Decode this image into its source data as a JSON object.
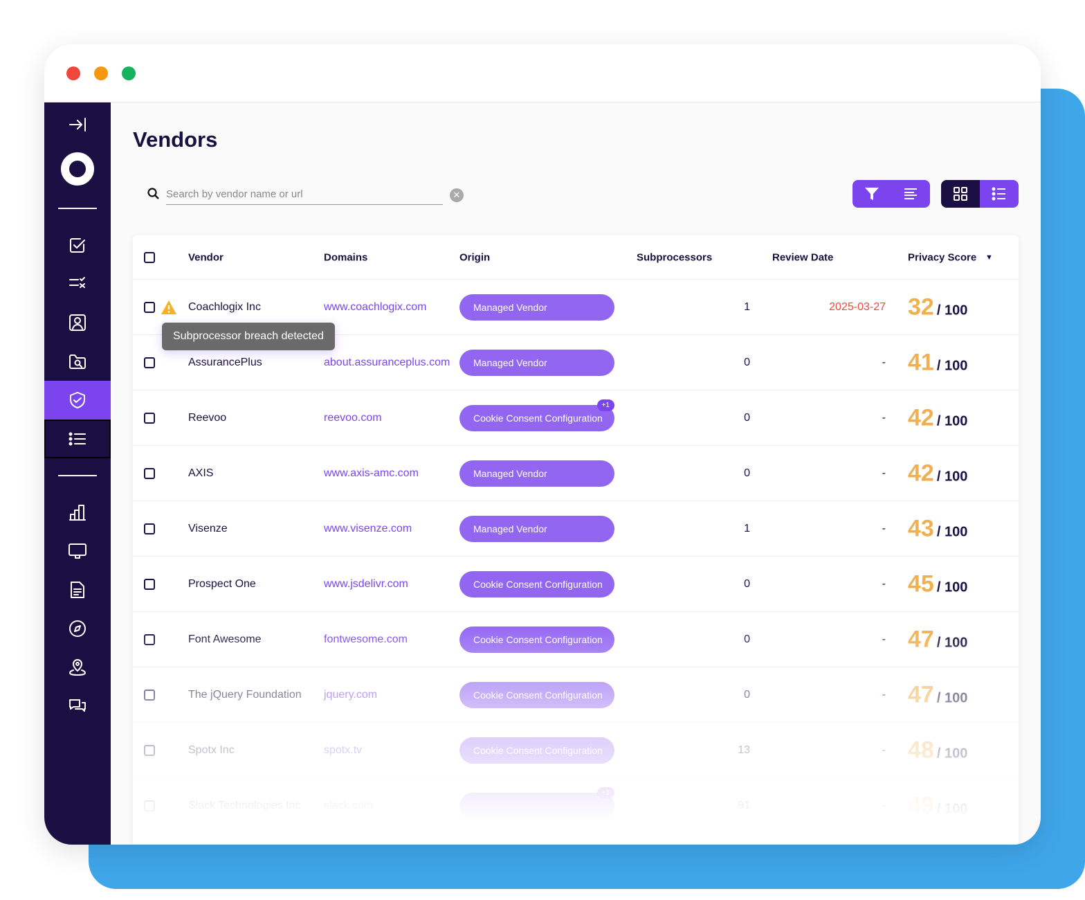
{
  "window": {
    "controls": [
      {
        "name": "close",
        "color": "#f0463c"
      },
      {
        "name": "minimize",
        "color": "#f7960f"
      },
      {
        "name": "maximize",
        "color": "#15b35d"
      }
    ]
  },
  "sidebar": {
    "items": [
      {
        "icon": "expand-icon"
      },
      {
        "icon": "logo-ring-icon"
      },
      {
        "icon": "checkbox-icon"
      },
      {
        "icon": "checklist-icon"
      },
      {
        "icon": "profile-icon"
      },
      {
        "icon": "folder-search-icon"
      },
      {
        "icon": "shield-check-icon",
        "active": true
      },
      {
        "icon": "list-icon",
        "selected": true
      },
      {
        "icon": "bar-chart-icon"
      },
      {
        "icon": "monitor-icon"
      },
      {
        "icon": "document-icon"
      },
      {
        "icon": "compass-icon"
      },
      {
        "icon": "location-icon"
      },
      {
        "icon": "chat-icon"
      }
    ]
  },
  "page": {
    "title": "Vendors"
  },
  "search": {
    "placeholder": "Search by vendor name or url",
    "value": ""
  },
  "toolbar": {
    "filter": "filter-icon",
    "sort": "sort-lines-icon",
    "grid_view": "grid-icon",
    "list_view": "list-icon",
    "accent": "#7c44ee",
    "dark": "#190f43"
  },
  "table": {
    "columns": [
      "Vendor",
      "Domains",
      "Origin",
      "Subprocessors",
      "Review Date",
      "Privacy Score"
    ],
    "sort_indicator": "▼",
    "tooltip": "Subprocessor breach detected",
    "rows": [
      {
        "vendor": "Coachlogix Inc",
        "warning": true,
        "domain": "www.coachlogix.com",
        "origin": "Managed Vendor",
        "extra": "",
        "subprocessors": "1",
        "review_date": "2025-03-27",
        "score": "32",
        "max": "/ 100"
      },
      {
        "vendor": "AssurancePlus",
        "domain": "about.assuranceplus.com",
        "origin": "Managed Vendor",
        "extra": "",
        "subprocessors": "0",
        "review_date": "-",
        "score": "41",
        "max": "/ 100"
      },
      {
        "vendor": "Reevoo",
        "domain": "reevoo.com",
        "origin": "Cookie Consent Configuration",
        "extra": "+1",
        "subprocessors": "0",
        "review_date": "-",
        "score": "42",
        "max": "/ 100"
      },
      {
        "vendor": "AXIS",
        "domain": "www.axis-amc.com",
        "origin": "Managed Vendor",
        "extra": "",
        "subprocessors": "0",
        "review_date": "-",
        "score": "42",
        "max": "/ 100"
      },
      {
        "vendor": "Visenze",
        "domain": "www.visenze.com",
        "origin": "Managed Vendor",
        "extra": "",
        "subprocessors": "1",
        "review_date": "-",
        "score": "43",
        "max": "/ 100"
      },
      {
        "vendor": "Prospect One",
        "domain": "www.jsdelivr.com",
        "origin": "Cookie Consent Configuration",
        "extra": "",
        "subprocessors": "0",
        "review_date": "-",
        "score": "45",
        "max": "/ 100"
      },
      {
        "vendor": "Font Awesome",
        "domain": "fontwesome.com",
        "origin": "Cookie Consent Configuration",
        "extra": "",
        "subprocessors": "0",
        "review_date": "-",
        "score": "47",
        "max": "/ 100"
      },
      {
        "vendor": "The jQuery Foundation",
        "domain": "jquery.com",
        "origin": "Cookie Consent Configuration",
        "extra": "",
        "subprocessors": "0",
        "review_date": "-",
        "score": "47",
        "max": "/ 100"
      },
      {
        "vendor": "Spotx Inc",
        "domain": "spotx.tv",
        "origin": "Cookie Consent Configuration",
        "extra": "",
        "subprocessors": "13",
        "review_date": "-",
        "score": "48",
        "max": "/ 100"
      },
      {
        "vendor": "Slack Technologies Inc",
        "domain": "slack.com",
        "origin": "",
        "extra": "+1",
        "subprocessors": "91",
        "review_date": "-",
        "score": "49",
        "max": "/ 100"
      }
    ]
  }
}
